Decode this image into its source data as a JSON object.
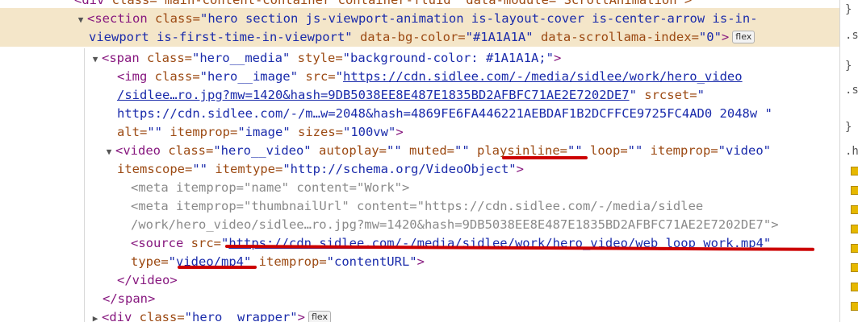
{
  "lines": {
    "l0": {
      "tag": "div",
      "text": " class=\"main-content-container container-fluid\" data-module=\"ScrollAnimation\">"
    },
    "l1": {
      "triangle": "▼",
      "open": "<section",
      "a1": " class=",
      "v1": "\"hero section js-viewport-animation is-layout-cover is-center-arrow is-in-"
    },
    "l2": {
      "v1": "viewport is-first-time-in-viewport\"",
      "a2": " data-bg-color=",
      "v2": "\"#1A1A1A\"",
      "a3": " data-scrollama-index=",
      "v3": "\"0\"",
      "close": ">",
      "badge": "flex"
    },
    "l3": {
      "triangle": "▼",
      "open": "<span",
      "a1": " class=",
      "v1": "\"hero__media\"",
      "a2": " style=",
      "v2": "\"background-color: #1A1A1A;\"",
      "close": ">"
    },
    "l4": {
      "open": "<img",
      "a1": " class=",
      "v1": "\"hero__image\"",
      "a2": " src=",
      "q": "\"",
      "link": "https://cdn.sidlee.com/-/media/sidlee/work/hero_video"
    },
    "l5": {
      "link": "/sidlee…ro.jpg?mw=1420&hash=9DB5038EE8E487E1835BD2AFBFC71AE2E7202DE7",
      "q": "\"",
      "a3": " srcset=",
      "v3": "\""
    },
    "l6": {
      "v": "https://cdn.sidlee.com/-/m…w=2048&hash=4869FE6FA446221AEBDAF1B2DCFFCE9725FC4AD0 2048w \""
    },
    "l7": {
      "a1": "alt=",
      "v1": "\"\"",
      "a2": " itemprop=",
      "v2": "\"image\"",
      "a3": " sizes=",
      "v3": "\"100vw\"",
      "close": ">"
    },
    "l8": {
      "triangle": "▼",
      "open": "<video",
      "a1": " class=",
      "v1": "\"hero__video\"",
      "a2": " autoplay=",
      "v2": "\"\"",
      "a3": " muted=",
      "v3": "\"\"",
      "a4": "playsinline",
      "a4eq": "=",
      "v4": "\"\"",
      "a5": " loop=",
      "v5": "\"\"",
      "a6": " itemprop=",
      "v6": "\"video\""
    },
    "l9": {
      "a1": "itemscope=",
      "v1": "\"\"",
      "a2": " itemtype=",
      "v2": "\"http://schema.org/VideoObject\"",
      "close": ">"
    },
    "l10": {
      "open": "<meta",
      "a1": " itemprop=",
      "v1": "\"name\"",
      "a2": " content=",
      "v2": "\"Work\"",
      "close": ">"
    },
    "l11": {
      "open": "<meta",
      "a1": " itemprop=",
      "v1": "\"thumbnailUrl\"",
      "a2": " content=",
      "v2": "\"https://cdn.sidlee.com/-/media/sidlee"
    },
    "l12": {
      "v": "/work/hero_video/sidlee…ro.jpg?mw=1420&hash=9DB5038EE8E487E1835BD2AFBFC71AE2E7202DE7\"",
      "close": ">"
    },
    "l13": {
      "open": "<source",
      "a1": " src=",
      "q": "\"",
      "link": "https://cdn.sidlee.com/-/media/sidlee/work/hero_video/web_loop_work.mp4",
      "q2": "\""
    },
    "l14": {
      "a1": "type=",
      "v1": "\"video/mp4\"",
      "a2": " itemprop=",
      "v2": "\"contentURL\"",
      "close": ">"
    },
    "l15": {
      "text": "</video>"
    },
    "l16": {
      "text": "</span>"
    },
    "l17": {
      "triangle": "▶",
      "open": "<div",
      "a1": " class=",
      "v1": "\"hero__wrapper\"",
      "close": ">",
      "badge": "flex"
    }
  },
  "right_pane": {
    "items": [
      "}",
      ".s",
      "}",
      ".s",
      "}",
      ".h"
    ]
  },
  "colors": {
    "highlight": "#f4e6c9",
    "annotation": "#cc0000",
    "tag": "#87187f",
    "attr_name": "#9c4a13",
    "attr_value": "#1a2bab"
  }
}
